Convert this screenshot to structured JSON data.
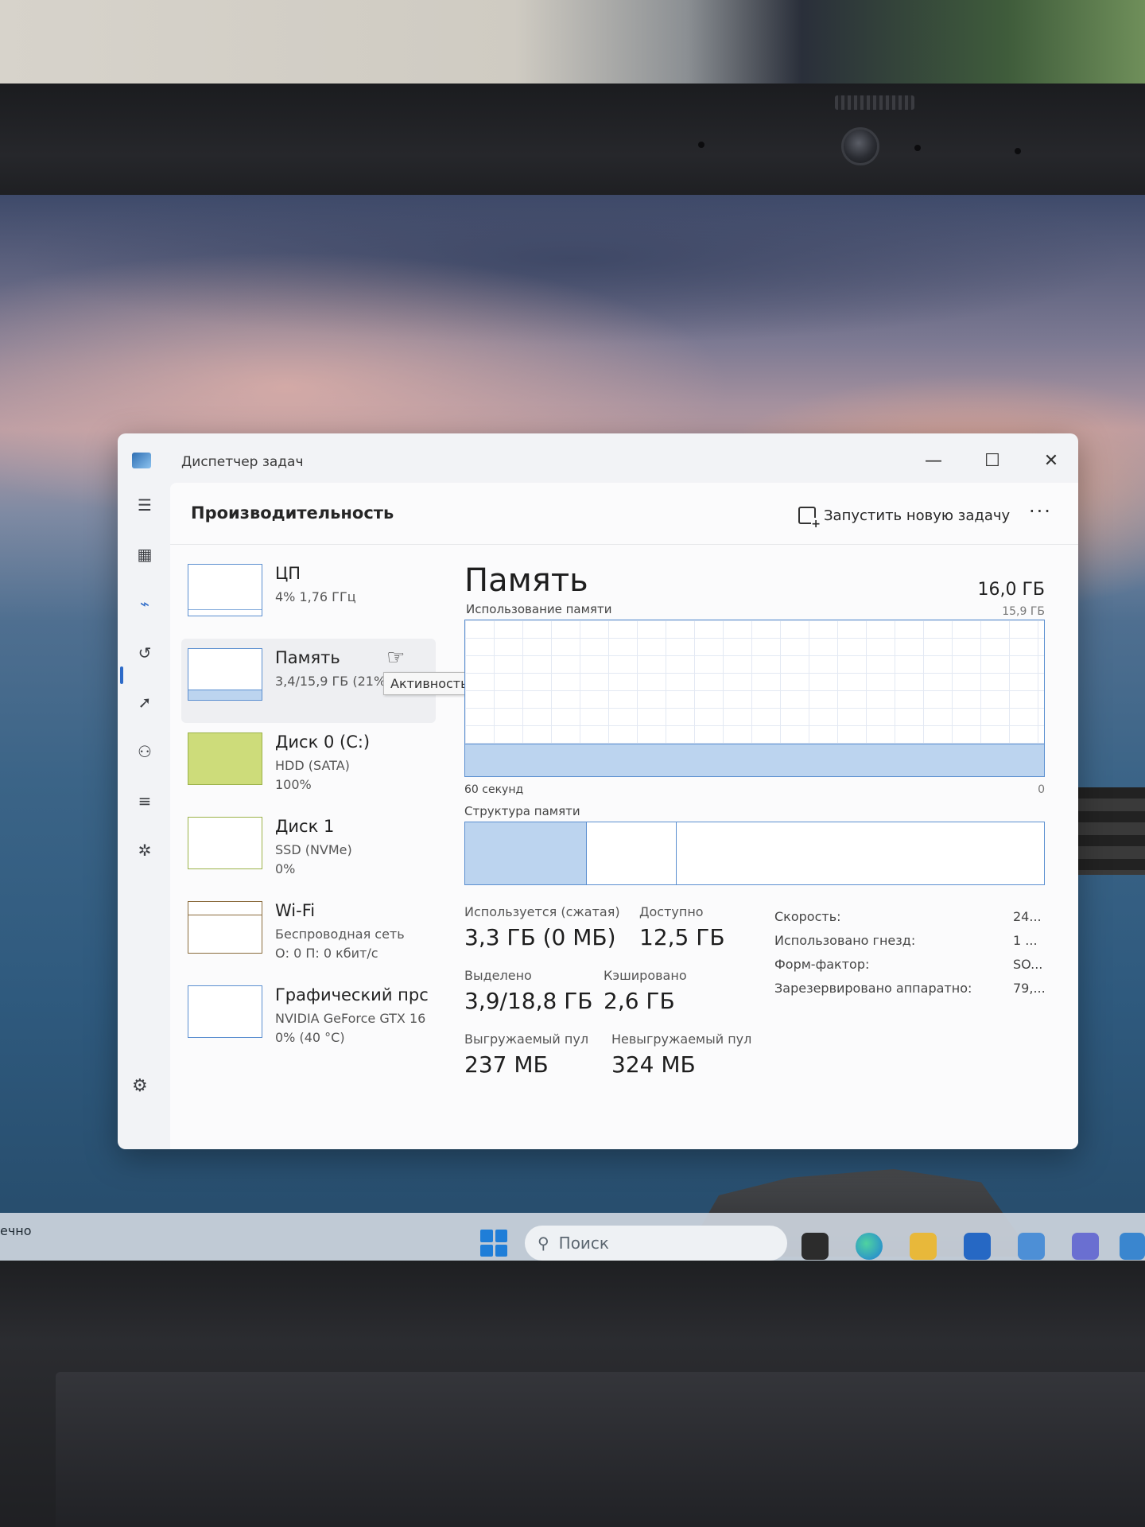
{
  "window": {
    "title": "Диспетчер задач",
    "minimize": "—",
    "maximize": "☐",
    "close": "✕"
  },
  "header": {
    "title": "Производительность",
    "new_task_label": "Запустить новую задачу",
    "more": "···"
  },
  "nav": {
    "items": [
      {
        "name": "menu-icon",
        "glyph": "☰"
      },
      {
        "name": "processes-icon",
        "glyph": "▦"
      },
      {
        "name": "performance-icon",
        "glyph": "⌁"
      },
      {
        "name": "app-history-icon",
        "glyph": "↺"
      },
      {
        "name": "startup-apps-icon",
        "glyph": "➚"
      },
      {
        "name": "users-icon",
        "glyph": "⚇"
      },
      {
        "name": "details-icon",
        "glyph": "≡"
      },
      {
        "name": "services-icon",
        "glyph": "✲"
      }
    ],
    "settings_glyph": "⚙"
  },
  "resources": [
    {
      "name": "ЦП",
      "line1": "4% 1,76 ГГц",
      "line2": "",
      "line3": ""
    },
    {
      "name": "Память",
      "line1": "3,4/15,9 ГБ (21%)",
      "line2": "",
      "line3": ""
    },
    {
      "name": "Диск 0 (C:)",
      "line1": "HDD (SATA)",
      "line2": "100%",
      "line3": ""
    },
    {
      "name": "Диск 1",
      "line1": "SSD (NVMe)",
      "line2": "0%",
      "line3": ""
    },
    {
      "name": "Wi-Fi",
      "line1": "Беспроводная сеть",
      "line2": "О: 0 П: 0 кбит/с",
      "line3": ""
    },
    {
      "name": "Графический прс",
      "line1": "NVIDIA GeForce GTX 16",
      "line2": "0% (40 °C)",
      "line3": ""
    }
  ],
  "tooltip": "Активность ЦП",
  "memory": {
    "title": "Память",
    "total": "16,0 ГБ",
    "usage_label": "Использование памяти",
    "usage_max": "15,9 ГБ",
    "usage_fraction": 0.21,
    "time_label": "60 секунд",
    "time_end": "0",
    "structure_label": "Структура памяти",
    "structure_fractions": [
      0.21,
      0.155,
      0.635
    ],
    "stats": {
      "in_use_label": "Используется (сжатая)",
      "in_use_value": "3,3 ГБ (0 МБ)",
      "available_label": "Доступно",
      "available_value": "12,5 ГБ",
      "committed_label": "Выделено",
      "committed_value": "3,9/18,8 ГБ",
      "cached_label": "Кэшировано",
      "cached_value": "2,6 ГБ",
      "paged_label": "Выгружаемый пул",
      "paged_value": "237 МБ",
      "nonpaged_label": "Невыгружаемый пул",
      "nonpaged_value": "324 МБ"
    },
    "specs": [
      {
        "label": "Скорость:",
        "value": "24..."
      },
      {
        "label": "Использовано гнезд:",
        "value": "1 ..."
      },
      {
        "label": "Форм-фактор:",
        "value": "SO..."
      },
      {
        "label": "Зарезервировано аппаратно:",
        "value": "79,..."
      }
    ]
  },
  "taskbar": {
    "search_placeholder": "Поиск",
    "left_fragment": "ечно"
  },
  "colors": {
    "accent": "#2d6ac8",
    "graph_line": "#5b8fd0",
    "graph_fill": "#bcd4ef",
    "disk_fill": "#cddc7a"
  }
}
